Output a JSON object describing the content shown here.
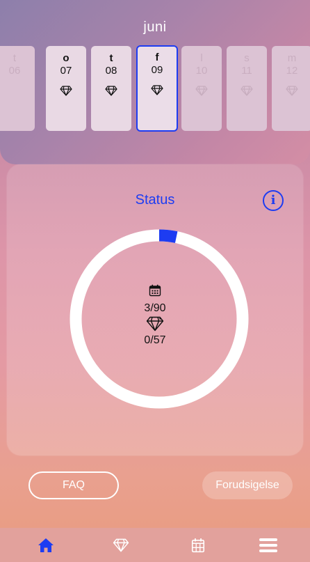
{
  "calendar": {
    "month": "juni",
    "days": [
      {
        "name": "t",
        "num": "06",
        "state": "faded",
        "has_gem": false
      },
      {
        "name": "o",
        "num": "07",
        "state": "normal",
        "has_gem": true
      },
      {
        "name": "t",
        "num": "08",
        "state": "normal",
        "has_gem": true
      },
      {
        "name": "f",
        "num": "09",
        "state": "selected",
        "has_gem": true
      },
      {
        "name": "l",
        "num": "10",
        "state": "faded",
        "has_gem": true
      },
      {
        "name": "s",
        "num": "11",
        "state": "faded",
        "has_gem": true
      },
      {
        "name": "m",
        "num": "12",
        "state": "faded",
        "has_gem": true
      }
    ]
  },
  "status": {
    "title": "Status",
    "info_icon": "info-icon",
    "progress_fraction": 0.033,
    "days_value": "3/90",
    "gems_value": "0/57"
  },
  "actions": {
    "faq_label": "FAQ",
    "forecast_label": "Forudsigelse"
  },
  "nav": {
    "items": [
      "home-icon",
      "diamond-icon",
      "calendar-icon",
      "menu-icon"
    ],
    "active": "home-icon"
  },
  "colors": {
    "accent": "#1d3cf2",
    "ring": "#ffffff"
  }
}
